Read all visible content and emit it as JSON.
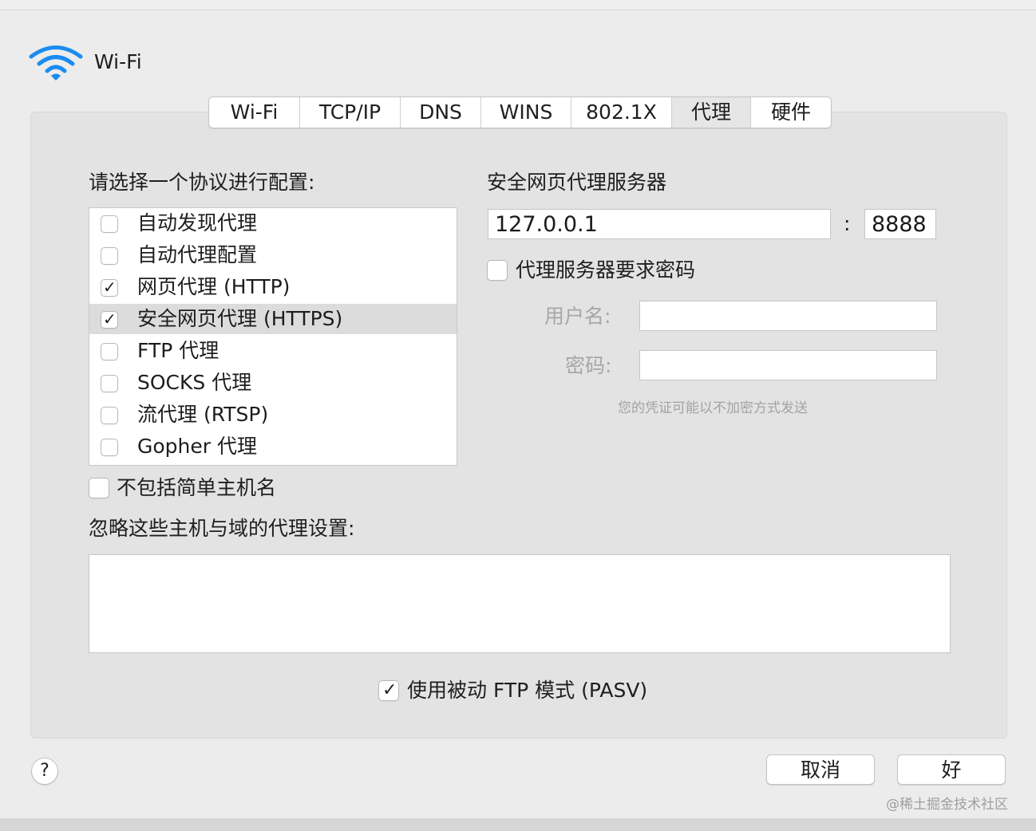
{
  "header": {
    "title": "Wi-Fi",
    "icon": "wifi-icon",
    "accent": "#1a8cf0"
  },
  "tabs": [
    {
      "label": "Wi-Fi",
      "active": false
    },
    {
      "label": "TCP/IP",
      "active": false
    },
    {
      "label": "DNS",
      "active": false
    },
    {
      "label": "WINS",
      "active": false
    },
    {
      "label": "802.1X",
      "active": false
    },
    {
      "label": "代理",
      "active": true
    },
    {
      "label": "硬件",
      "active": false
    }
  ],
  "protocol_section": {
    "title": "请选择一个协议进行配置:",
    "items": [
      {
        "label": "自动发现代理",
        "checked": false,
        "selected": false
      },
      {
        "label": "自动代理配置",
        "checked": false,
        "selected": false
      },
      {
        "label": "网页代理 (HTTP)",
        "checked": true,
        "selected": false
      },
      {
        "label": "安全网页代理 (HTTPS)",
        "checked": true,
        "selected": true
      },
      {
        "label": "FTP 代理",
        "checked": false,
        "selected": false
      },
      {
        "label": "SOCKS 代理",
        "checked": false,
        "selected": false
      },
      {
        "label": "流代理 (RTSP)",
        "checked": false,
        "selected": false
      },
      {
        "label": "Gopher 代理",
        "checked": false,
        "selected": false
      }
    ]
  },
  "server_section": {
    "title": "安全网页代理服务器",
    "host": "127.0.0.1",
    "separator": ":",
    "port": "8888",
    "password_required_label": "代理服务器要求密码",
    "password_required": false,
    "username_label": "用户名:",
    "username": "",
    "password_label": "密码:",
    "password": "",
    "note": "您的凭证可能以不加密方式发送"
  },
  "exclude_simple": {
    "label": "不包括简单主机名",
    "checked": false
  },
  "bypass": {
    "label": "忽略这些主机与域的代理设置:",
    "value": ""
  },
  "pasv": {
    "label": "使用被动 FTP 模式 (PASV)",
    "checked": true
  },
  "buttons": {
    "help": "?",
    "cancel": "取消",
    "ok": "好"
  },
  "watermark": "@稀土掘金技术社区"
}
